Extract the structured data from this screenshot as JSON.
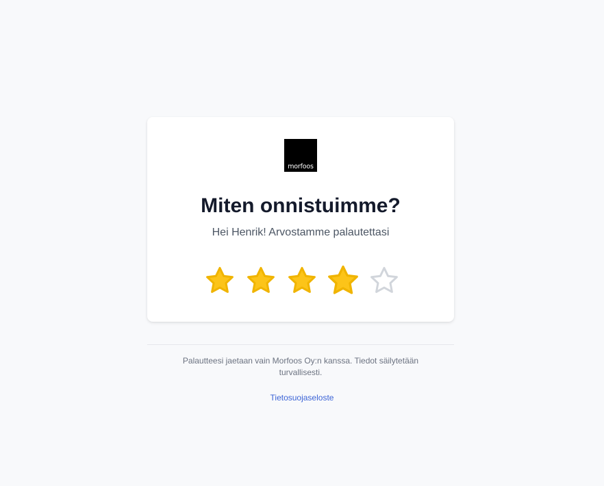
{
  "brand": {
    "logo_text": "morfoos",
    "logo_bg_color": "#000000"
  },
  "card": {
    "title": "Miten onnistuimme?",
    "subtitle": "Hei Henrik! Arvostamme palautettasi"
  },
  "rating": {
    "value": 4,
    "max": 5,
    "filled_color": "#fcc419",
    "filled_stroke": "#f0b400",
    "empty_stroke": "#d1d5db",
    "stars": [
      {
        "label": "1",
        "filled": true
      },
      {
        "label": "2",
        "filled": true
      },
      {
        "label": "3",
        "filled": true
      },
      {
        "label": "4",
        "filled": true,
        "hovered": true
      },
      {
        "label": "5",
        "filled": false
      }
    ]
  },
  "footer": {
    "note": "Palautteesi jaetaan vain Morfoos Oy:n kanssa. Tiedot säilytetään turvallisesti.",
    "privacy_link": "Tietosuojaseloste"
  }
}
